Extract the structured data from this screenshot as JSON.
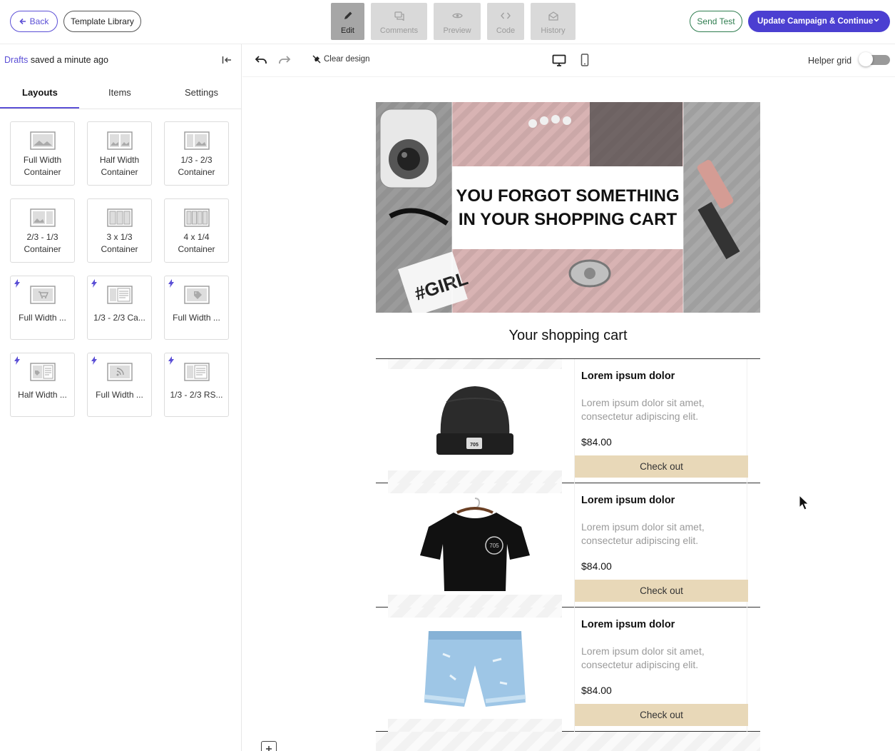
{
  "topbar": {
    "back_label": "Back",
    "template_library_label": "Template Library",
    "modes": [
      {
        "label": "Edit",
        "icon": "pencil-icon",
        "active": true
      },
      {
        "label": "Comments",
        "icon": "comments-icon",
        "active": false
      },
      {
        "label": "Preview",
        "icon": "eye-icon",
        "active": false
      },
      {
        "label": "Code",
        "icon": "code-icon",
        "active": false
      },
      {
        "label": "History",
        "icon": "envelope-icon",
        "active": false
      }
    ],
    "send_test_label": "Send Test",
    "update_label": "Update Campaign & Continue"
  },
  "sidebar": {
    "drafts_link": "Drafts",
    "saved_text": "saved a minute ago",
    "tabs": [
      "Layouts",
      "Items",
      "Settings"
    ],
    "active_tab": "Layouts",
    "layouts": [
      {
        "label": "Full Width Container",
        "icon": "full-width-layout-icon",
        "dynamic": false
      },
      {
        "label": "Half Width Container",
        "icon": "half-width-layout-icon",
        "dynamic": false
      },
      {
        "label": "1/3 - 2/3 Container",
        "icon": "one-third-two-thirds-layout-icon",
        "dynamic": false
      },
      {
        "label": "2/3 - 1/3 Container",
        "icon": "two-thirds-one-third-layout-icon",
        "dynamic": false
      },
      {
        "label": "3 x 1/3 Container",
        "icon": "three-column-layout-icon",
        "dynamic": false
      },
      {
        "label": "4 x 1/4 Container",
        "icon": "four-column-layout-icon",
        "dynamic": false
      },
      {
        "label": "Full Width ...",
        "icon": "cart-layout-icon",
        "dynamic": true
      },
      {
        "label": "1/3 - 2/3 Ca...",
        "icon": "catalog-layout-icon",
        "dynamic": true
      },
      {
        "label": "Full Width ...",
        "icon": "tag-layout-icon",
        "dynamic": true
      },
      {
        "label": "Half Width ...",
        "icon": "tag-half-layout-icon",
        "dynamic": true
      },
      {
        "label": "Full Width ...",
        "icon": "rss-layout-icon",
        "dynamic": true
      },
      {
        "label": "1/3 - 2/3 RS...",
        "icon": "rss-split-layout-icon",
        "dynamic": true
      }
    ]
  },
  "editor_toolbar": {
    "clear_design_label": "Clear design",
    "helper_grid_label": "Helper grid",
    "helper_grid_on": false
  },
  "email": {
    "hero_title": "YOU FORGOT SOMETHING IN YOUR SHOPPING CART",
    "cart_title": "Your shopping cart",
    "products": [
      {
        "name": "Lorem ipsum dolor",
        "desc": "Lorem ipsum dolor sit amet, consectetur adipiscing elit.",
        "price": "$84.00",
        "button": "Check out",
        "image": "beanie"
      },
      {
        "name": "Lorem ipsum dolor",
        "desc": "Lorem ipsum dolor sit amet, consectetur adipiscing elit.",
        "price": "$84.00",
        "button": "Check out",
        "image": "tshirt"
      },
      {
        "name": "Lorem ipsum dolor",
        "desc": "Lorem ipsum dolor sit amet, consectetur adipiscing elit.",
        "price": "$84.00",
        "button": "Check out",
        "image": "shorts"
      }
    ]
  },
  "colors": {
    "accent": "#4b3fd1",
    "send_test": "#2e7d4f",
    "checkout_button": "#e8d8b8"
  }
}
